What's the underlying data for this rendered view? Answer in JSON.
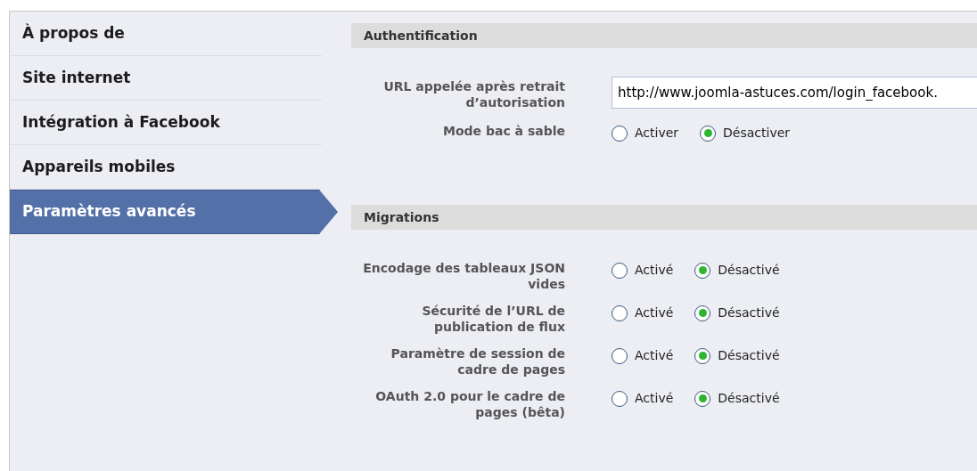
{
  "sidebar": {
    "items": [
      {
        "label": "À propos de",
        "selected": false
      },
      {
        "label": "Site internet",
        "selected": false
      },
      {
        "label": "Intégration à Facebook",
        "selected": false
      },
      {
        "label": "Appareils mobiles",
        "selected": false
      },
      {
        "label": "Paramètres avancés",
        "selected": true
      }
    ]
  },
  "sections": [
    {
      "title": "Authentification",
      "fields": [
        {
          "kind": "text",
          "label": "URL appelée après retrait d’autorisation",
          "value": "http://www.joomla-astuces.com/login_facebook."
        },
        {
          "kind": "radio",
          "label": "Mode bac à sable",
          "options": [
            {
              "label": "Activer",
              "selected": false
            },
            {
              "label": "Désactiver",
              "selected": true
            }
          ]
        }
      ]
    },
    {
      "title": "Migrations",
      "fields": [
        {
          "kind": "radio",
          "label": "Encodage des tableaux JSON vides",
          "options": [
            {
              "label": "Activé",
              "selected": false
            },
            {
              "label": "Désactivé",
              "selected": true
            }
          ]
        },
        {
          "kind": "radio",
          "label": "Sécurité de l’URL de publication de flux",
          "options": [
            {
              "label": "Activé",
              "selected": false
            },
            {
              "label": "Désactivé",
              "selected": true
            }
          ]
        },
        {
          "kind": "radio",
          "label": "Paramètre de session de cadre de pages",
          "options": [
            {
              "label": "Activé",
              "selected": false
            },
            {
              "label": "Désactivé",
              "selected": true
            }
          ]
        },
        {
          "kind": "radio",
          "label": "OAuth 2.0 pour le cadre de pages (bêta)",
          "options": [
            {
              "label": "Activé",
              "selected": false
            },
            {
              "label": "Désactivé",
              "selected": true
            }
          ]
        }
      ]
    }
  ]
}
